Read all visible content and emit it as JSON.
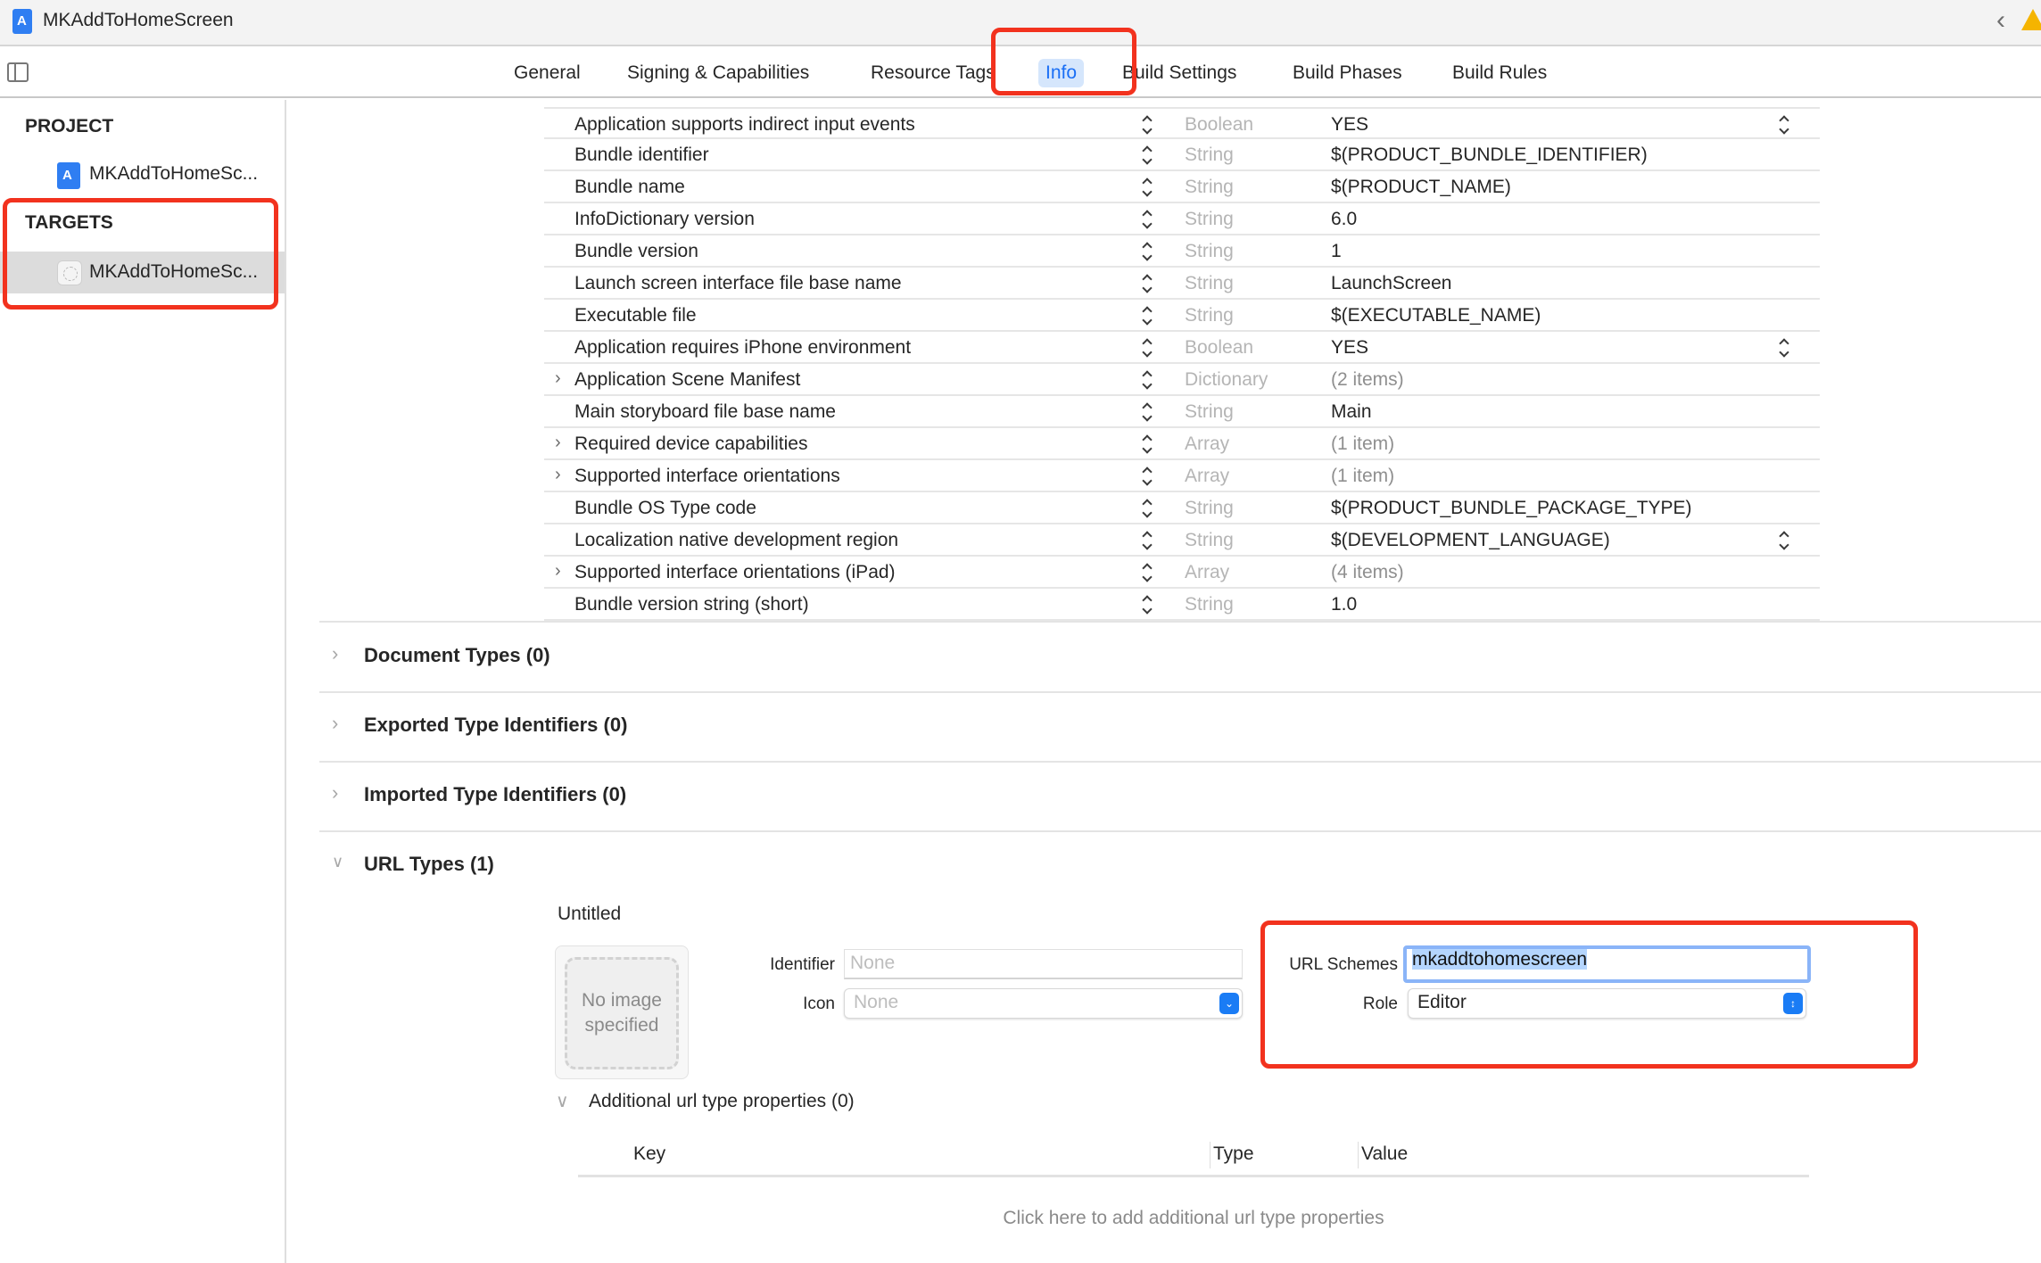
{
  "window": {
    "title": "MKAddToHomeScreen"
  },
  "tabs": [
    {
      "label": "General",
      "active": false
    },
    {
      "label": "Signing & Capabilities",
      "active": false
    },
    {
      "label": "Resource Tags",
      "active": false
    },
    {
      "label": "Info",
      "active": true
    },
    {
      "label": "Build Settings",
      "active": false
    },
    {
      "label": "Build Phases",
      "active": false
    },
    {
      "label": "Build Rules",
      "active": false
    }
  ],
  "sidebar": {
    "project_header": "PROJECT",
    "project_item": "MKAddToHomeSc...",
    "targets_header": "TARGETS",
    "target_item": "MKAddToHomeSc..."
  },
  "properties": [
    {
      "key": "Application supports indirect input events",
      "type": "Boolean",
      "value": "YES",
      "expandable": false,
      "value_popup": true,
      "muted": false
    },
    {
      "key": "Bundle identifier",
      "type": "String",
      "value": "$(PRODUCT_BUNDLE_IDENTIFIER)",
      "expandable": false,
      "value_popup": false,
      "muted": false
    },
    {
      "key": "Bundle name",
      "type": "String",
      "value": "$(PRODUCT_NAME)",
      "expandable": false,
      "value_popup": false,
      "muted": false
    },
    {
      "key": "InfoDictionary version",
      "type": "String",
      "value": "6.0",
      "expandable": false,
      "value_popup": false,
      "muted": false
    },
    {
      "key": "Bundle version",
      "type": "String",
      "value": "1",
      "expandable": false,
      "value_popup": false,
      "muted": false
    },
    {
      "key": "Launch screen interface file base name",
      "type": "String",
      "value": "LaunchScreen",
      "expandable": false,
      "value_popup": false,
      "muted": false
    },
    {
      "key": "Executable file",
      "type": "String",
      "value": "$(EXECUTABLE_NAME)",
      "expandable": false,
      "value_popup": false,
      "muted": false
    },
    {
      "key": "Application requires iPhone environment",
      "type": "Boolean",
      "value": "YES",
      "expandable": false,
      "value_popup": true,
      "muted": false
    },
    {
      "key": "Application Scene Manifest",
      "type": "Dictionary",
      "value": "(2 items)",
      "expandable": true,
      "value_popup": false,
      "muted": true
    },
    {
      "key": "Main storyboard file base name",
      "type": "String",
      "value": "Main",
      "expandable": false,
      "value_popup": false,
      "muted": false
    },
    {
      "key": "Required device capabilities",
      "type": "Array",
      "value": "(1 item)",
      "expandable": true,
      "value_popup": false,
      "muted": true
    },
    {
      "key": "Supported interface orientations",
      "type": "Array",
      "value": "(1 item)",
      "expandable": true,
      "value_popup": false,
      "muted": true
    },
    {
      "key": "Bundle OS Type code",
      "type": "String",
      "value": "$(PRODUCT_BUNDLE_PACKAGE_TYPE)",
      "expandable": false,
      "value_popup": false,
      "muted": false
    },
    {
      "key": "Localization native development region",
      "type": "String",
      "value": "$(DEVELOPMENT_LANGUAGE)",
      "expandable": false,
      "value_popup": true,
      "muted": false
    },
    {
      "key": "Supported interface orientations (iPad)",
      "type": "Array",
      "value": "(4 items)",
      "expandable": true,
      "value_popup": false,
      "muted": true
    },
    {
      "key": "Bundle version string (short)",
      "type": "String",
      "value": "1.0",
      "expandable": false,
      "value_popup": false,
      "muted": false
    }
  ],
  "sections": [
    {
      "title": "Document Types (0)",
      "expanded": false
    },
    {
      "title": "Exported Type Identifiers (0)",
      "expanded": false
    },
    {
      "title": "Imported Type Identifiers (0)",
      "expanded": false
    },
    {
      "title": "URL Types (1)",
      "expanded": true
    }
  ],
  "url_type": {
    "name": "Untitled",
    "image_placeholder": "No image specified",
    "identifier_label": "Identifier",
    "identifier_placeholder": "None",
    "icon_label": "Icon",
    "icon_value": "None",
    "url_schemes_label": "URL Schemes",
    "url_schemes_value": "mkaddtohomescreen",
    "role_label": "Role",
    "role_value": "Editor",
    "additional_title": "Additional url type properties (0)",
    "table_columns": [
      "Key",
      "Type",
      "Value"
    ],
    "empty_hint": "Click here to add additional url type properties"
  },
  "colors": {
    "accent": "#1a7cf5",
    "active_tab_bg": "#d5e6fc",
    "annotation_red": "#f2321e",
    "warning": "#f5b400"
  }
}
